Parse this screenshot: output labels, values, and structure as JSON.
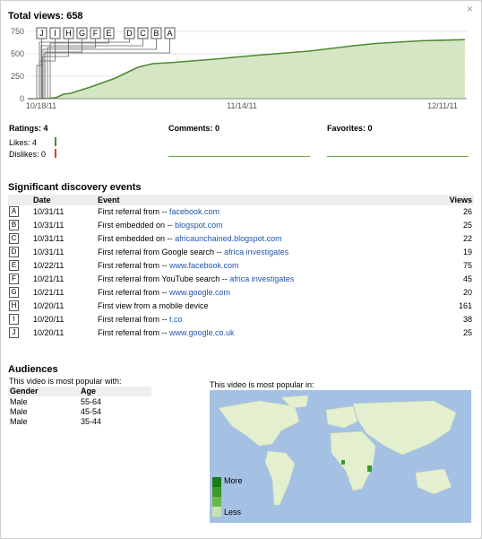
{
  "close_glyph": "×",
  "title": "Total views: 658",
  "chart_data": {
    "type": "area",
    "title": "Total views: 658",
    "x_tick_labels": [
      "10/18/11",
      "11/14/11",
      "12/11/11"
    ],
    "y_ticks": [
      "750",
      "500",
      "250",
      "0"
    ],
    "ylim": [
      0,
      750
    ],
    "x": [
      "10/18/11",
      "10/19/11",
      "10/20/11",
      "10/21/11",
      "10/22/11",
      "10/25/11",
      "10/28/11",
      "10/30/11",
      "10/31/11",
      "11/02/11",
      "11/05/11",
      "11/08/11",
      "11/11/11",
      "11/14/11",
      "11/17/11",
      "11/20/11",
      "11/23/11",
      "11/26/11",
      "11/29/11",
      "12/02/11",
      "12/05/11",
      "12/08/11",
      "12/11/11",
      "12/14/11"
    ],
    "values": [
      0,
      3,
      12,
      50,
      60,
      140,
      230,
      310,
      350,
      390,
      405,
      425,
      445,
      470,
      490,
      510,
      530,
      560,
      590,
      615,
      630,
      645,
      652,
      658
    ],
    "grid": true,
    "event_markers": [
      "J",
      "I",
      "H",
      "G",
      "F",
      "E",
      "D",
      "C",
      "B",
      "A"
    ],
    "fill_color": "#d6e6c4",
    "line_color": "#4e8a32"
  },
  "stats": {
    "ratings": "Ratings: 4",
    "likes": "Likes: 4",
    "dislikes": "Dislikes: 0",
    "comments": "Comments: 0",
    "favorites": "Favorites: 0"
  },
  "events": {
    "heading": "Significant discovery events",
    "columns": {
      "date": "Date",
      "event": "Event",
      "views": "Views"
    },
    "rows": [
      {
        "mark": "A",
        "date": "10/31/11",
        "event": "First referral from --",
        "link": "facebook.com",
        "views": "26"
      },
      {
        "mark": "B",
        "date": "10/31/11",
        "event": "First embedded on --",
        "link": "blogspot.com",
        "views": "25"
      },
      {
        "mark": "C",
        "date": "10/31/11",
        "event": "First embedded on --",
        "link": "africaunchained.blogspot.com",
        "views": "22"
      },
      {
        "mark": "D",
        "date": "10/31/11",
        "event": "First referral from Google search --",
        "link": "africa investigates",
        "views": "19"
      },
      {
        "mark": "E",
        "date": "10/22/11",
        "event": "First referral from --",
        "link": "www.facebook.com",
        "views": "75"
      },
      {
        "mark": "F",
        "date": "10/21/11",
        "event": "First referral from YouTube search --",
        "link": "africa investigates",
        "views": "45"
      },
      {
        "mark": "G",
        "date": "10/21/11",
        "event": "First referral from --",
        "link": "www.google.com",
        "views": "20"
      },
      {
        "mark": "H",
        "date": "10/20/11",
        "event": "First view from a mobile device",
        "link": "",
        "views": "161"
      },
      {
        "mark": "I",
        "date": "10/20/11",
        "event": "First referral from --",
        "link": "t.co",
        "views": "38"
      },
      {
        "mark": "J",
        "date": "10/20/11",
        "event": "First referral from --",
        "link": "www.google.co.uk",
        "views": "25"
      }
    ]
  },
  "audiences": {
    "heading": "Audiences",
    "subtitle": "This video is most popular with:",
    "columns": {
      "gender": "Gender",
      "age": "Age"
    },
    "rows": [
      {
        "gender": "Male",
        "age": "55-64"
      },
      {
        "gender": "Male",
        "age": "45-54"
      },
      {
        "gender": "Male",
        "age": "35-44"
      }
    ],
    "map_title": "This video is most popular in:",
    "legend_more": "More",
    "legend_less": "Less"
  },
  "colors": {
    "accent_green": "#4e8a32",
    "dislike_red": "#cc4444",
    "link_blue": "#2255aa",
    "map_ocean": "#a4c1e4",
    "land_light": "#e4efcf",
    "land_dark": "#3a9a2a"
  }
}
